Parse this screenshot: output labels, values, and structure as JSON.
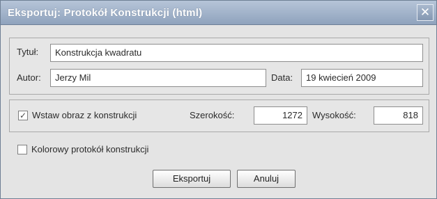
{
  "window": {
    "title": "Eksportuj: Protokół Konstrukcji (html)",
    "close_glyph": "✕"
  },
  "form": {
    "title_label": "Tytuł:",
    "title_value": "Konstrukcja kwadratu",
    "author_label": "Autor:",
    "author_value": "Jerzy Mil",
    "date_label": "Data:",
    "date_value": "19 kwiecień 2009"
  },
  "image_options": {
    "insert_label": "Wstaw obraz z konstrukcji",
    "insert_checked": true,
    "width_label": "Szerokość:",
    "width_value": "1272",
    "height_label": "Wysokość:",
    "height_value": "818"
  },
  "color_option": {
    "label": "Kolorowy protokół konstrukcji",
    "checked": false
  },
  "buttons": {
    "export_label": "Eksportuj",
    "cancel_label": "Anuluj"
  },
  "glyphs": {
    "check_mark": "✓"
  }
}
